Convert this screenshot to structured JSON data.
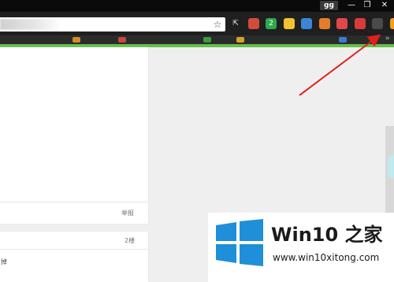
{
  "window": {
    "user_badge": "gg",
    "minimize_glyph": "—",
    "restore_glyph": "❐",
    "close_glyph": "✕"
  },
  "toolbar": {
    "star_glyph": "☆",
    "extensions": [
      {
        "name": "cursor-extension-icon",
        "glyph": "⇱",
        "color": "#1f1f1f"
      },
      {
        "name": "colorful-extension-icon",
        "glyph": "",
        "color": "#d44b3c"
      },
      {
        "name": "shield-extension-icon",
        "glyph": "2",
        "color": "#2fa84f"
      },
      {
        "name": "bulb-extension-icon",
        "glyph": "",
        "color": "#f2c230"
      },
      {
        "name": "globe-extension-icon",
        "glyph": "",
        "color": "#3e84d6"
      },
      {
        "name": "orange-extension-icon",
        "glyph": "",
        "color": "#e57c2d"
      },
      {
        "name": "red-shield-extension-icon",
        "glyph": "",
        "color": "#e04848"
      },
      {
        "name": "red-circle-extension-icon",
        "glyph": "",
        "color": "#d83b3b"
      },
      {
        "name": "download-icon",
        "glyph": "",
        "color": "#4a4a4a"
      },
      {
        "name": "orange-badge-extension-icon",
        "glyph": "",
        "color": "#f0a020"
      }
    ]
  },
  "content": {
    "report_label": "举报",
    "floor_label": "2楼",
    "comment_fragment": "掉"
  },
  "watermark": {
    "title": "Win10 之家",
    "url": "www.win10xitong.com"
  },
  "colors": {
    "accent_green": "#63c04a",
    "arrow_red": "#e0201a",
    "logo_blue": "#1e8fd8"
  }
}
